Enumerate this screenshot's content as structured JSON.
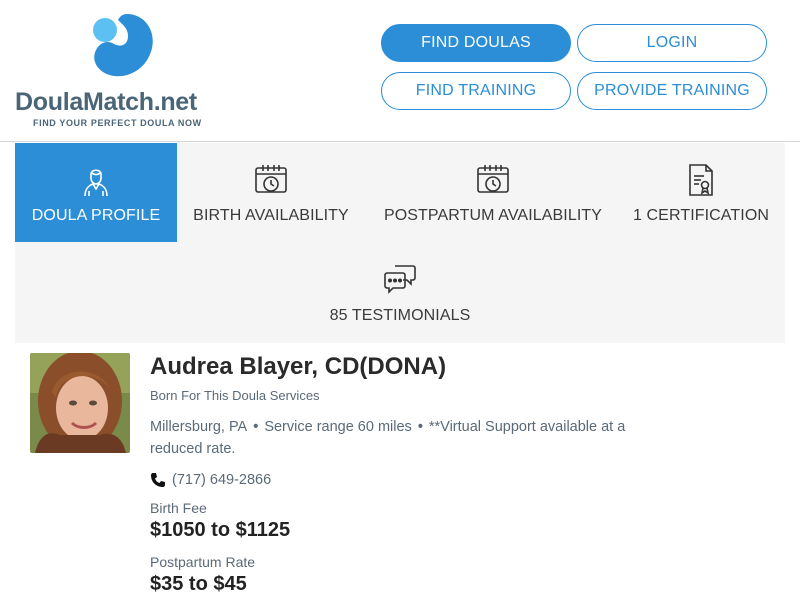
{
  "brand": {
    "name_main": "DoulaMatch",
    "name_tld": ".net",
    "tagline": "FIND YOUR PERFECT DOULA NOW",
    "accent_color": "#2b8ed6"
  },
  "nav": {
    "find_doulas": "FIND DOULAS",
    "login": "LOGIN",
    "find_training": "FIND TRAINING",
    "provide_training": "PROVIDE TRAINING"
  },
  "tabs": [
    {
      "label": "DOULA PROFILE",
      "icon": "doula-person-icon",
      "active": true
    },
    {
      "label": "BIRTH AVAILABILITY",
      "icon": "calendar-clock-icon",
      "active": false
    },
    {
      "label": "POSTPARTUM AVAILABILITY",
      "icon": "calendar-clock-icon",
      "active": false
    },
    {
      "label": "1 CERTIFICATION",
      "icon": "certificate-icon",
      "active": false
    },
    {
      "label": "85 TESTIMONIALS",
      "icon": "chat-bubbles-icon",
      "active": false
    }
  ],
  "profile": {
    "name": "Audrea Blayer, CD(DONA)",
    "business": "Born For This Doula Services",
    "location": "Millersburg, PA",
    "service_range": "Service range 60 miles",
    "virtual_note": "**Virtual Support available at a reduced rate.",
    "phone": "(717) 649-2866",
    "birth_fee_label": "Birth Fee",
    "birth_fee": "$1050 to $1125",
    "postpartum_label": "Postpartum Rate",
    "postpartum_rate": "$35 to $45"
  }
}
